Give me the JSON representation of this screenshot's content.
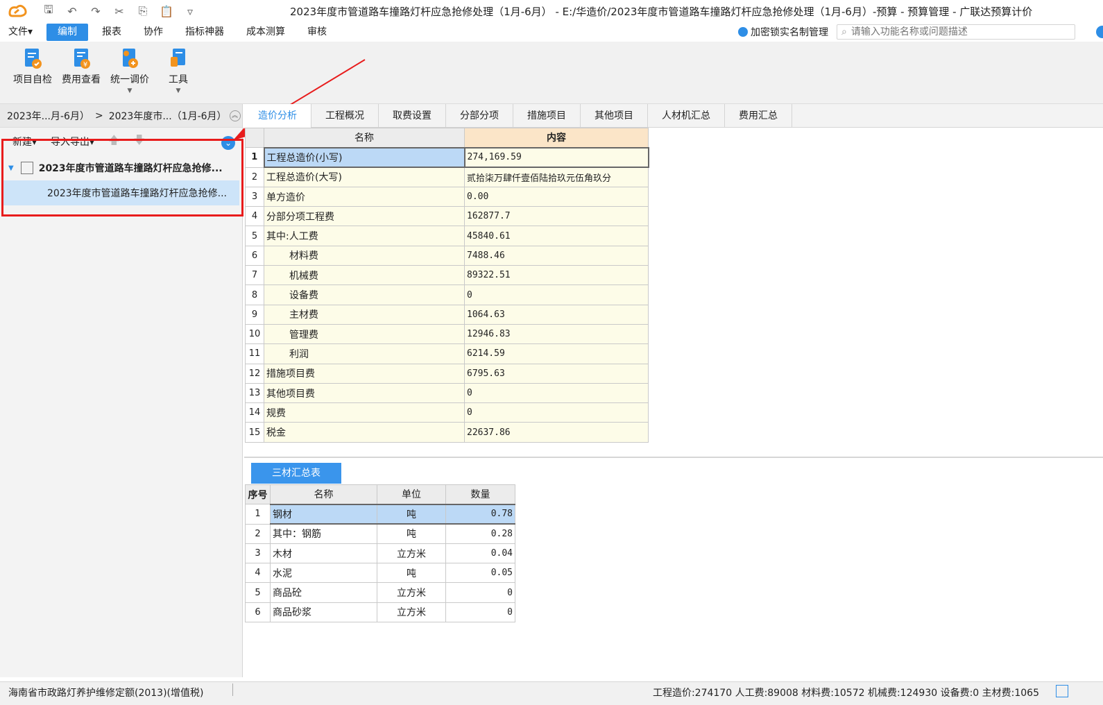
{
  "titlebar": {
    "title": "2023年度市管道路车撞路灯杆应急抢修处理（1月-6月） - E:/华造价/2023年度市管道路车撞路灯杆应急抢修处理（1月-6月）-预算 - 预算管理 - 广联达预算计价"
  },
  "menu": {
    "items": [
      "文件▾",
      "编制",
      "报表",
      "协作",
      "指标神器",
      "成本测算",
      "审核"
    ],
    "active": "编制",
    "lock_label": "加密锁实名制管理",
    "search_placeholder": "请输入功能名称或问题描述"
  },
  "ribbon": {
    "buttons": [
      {
        "label": "项目自检",
        "icon": "check-doc-icon",
        "dropdown": false
      },
      {
        "label": "费用查看",
        "icon": "fee-view-icon",
        "dropdown": false
      },
      {
        "label": "统一调价",
        "icon": "adjust-price-icon",
        "dropdown": true
      },
      {
        "label": "工具",
        "icon": "tools-icon",
        "dropdown": true
      }
    ]
  },
  "left": {
    "breadcrumb": [
      "2023年...月-6月）",
      "2023年度市...（1月-6月）"
    ],
    "toolbar": {
      "new": "新建▾",
      "import_export": "导入导出▾"
    },
    "tree": {
      "root": "2023年度市管道路车撞路灯杆应急抢修...",
      "child": "2023年度市管道路车撞路灯杆应急抢修..."
    }
  },
  "tabs": [
    "造价分析",
    "工程概况",
    "取费设置",
    "分部分项",
    "措施项目",
    "其他项目",
    "人材机汇总",
    "费用汇总"
  ],
  "main_table": {
    "headers": [
      "名称",
      "内容"
    ],
    "rows": [
      {
        "no": "1",
        "name": "工程总造价(小写)",
        "value": "274,169.59",
        "indent": false
      },
      {
        "no": "2",
        "name": "工程总造价(大写)",
        "value": "贰拾柒万肆仟壹佰陆拾玖元伍角玖分",
        "indent": false
      },
      {
        "no": "3",
        "name": "单方造价",
        "value": "0.00",
        "indent": false
      },
      {
        "no": "4",
        "name": "分部分项工程费",
        "value": "162877.7",
        "indent": false
      },
      {
        "no": "5",
        "name": "其中:人工费",
        "value": "45840.61",
        "indent": false
      },
      {
        "no": "6",
        "name": "材料费",
        "value": "7488.46",
        "indent": true
      },
      {
        "no": "7",
        "name": "机械费",
        "value": "89322.51",
        "indent": true
      },
      {
        "no": "8",
        "name": "设备费",
        "value": "0",
        "indent": true
      },
      {
        "no": "9",
        "name": "主材费",
        "value": "1064.63",
        "indent": true
      },
      {
        "no": "10",
        "name": "管理费",
        "value": "12946.83",
        "indent": true
      },
      {
        "no": "11",
        "name": "利润",
        "value": "6214.59",
        "indent": true
      },
      {
        "no": "12",
        "name": "措施项目费",
        "value": "6795.63",
        "indent": false
      },
      {
        "no": "13",
        "name": "其他项目费",
        "value": "0",
        "indent": false
      },
      {
        "no": "14",
        "name": "规费",
        "value": "0",
        "indent": false
      },
      {
        "no": "15",
        "name": "税金",
        "value": "22637.86",
        "indent": false
      }
    ]
  },
  "sub_tab": "三材汇总表",
  "sub_table": {
    "headers": [
      "序号",
      "名称",
      "单位",
      "数量"
    ],
    "rows": [
      {
        "no": "1",
        "name": "钢材",
        "unit": "吨",
        "qty": "0.78"
      },
      {
        "no": "2",
        "name": "其中：钢筋",
        "unit": "吨",
        "qty": "0.28"
      },
      {
        "no": "3",
        "name": "木材",
        "unit": "立方米",
        "qty": "0.04"
      },
      {
        "no": "4",
        "name": "水泥",
        "unit": "吨",
        "qty": "0.05"
      },
      {
        "no": "5",
        "name": "商品砼",
        "unit": "立方米",
        "qty": "0"
      },
      {
        "no": "6",
        "name": "商品砂浆",
        "unit": "立方米",
        "qty": "0"
      }
    ]
  },
  "status": {
    "left": "海南省市政路灯养护维修定额(2013)(增值税)",
    "right": "工程造价:274170  人工费:89008  材料费:10572  机械费:124930  设备费:0  主材费:1065"
  },
  "colors": {
    "accent": "#2e8ee6",
    "highlight": "#e81c1c",
    "content_header": "#fbe5c8",
    "cell_bg": "#fdfce8"
  }
}
